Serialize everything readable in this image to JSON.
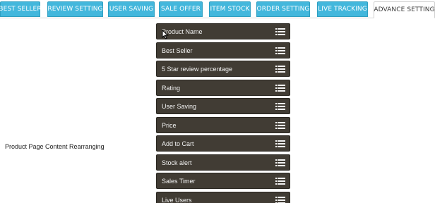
{
  "tabs": [
    {
      "label": "BEST SELLER",
      "active": false
    },
    {
      "label": "REVIEW SETTING",
      "active": false
    },
    {
      "label": "USER SAVING",
      "active": false
    },
    {
      "label": "SALE OFFER",
      "active": false
    },
    {
      "label": "ITEM STOCK",
      "active": false
    },
    {
      "label": "ORDER SETTING",
      "active": false
    },
    {
      "label": "LIVE TRACKING",
      "active": false
    },
    {
      "label": "ADVANCE SETTING",
      "active": true
    }
  ],
  "section_label": "Product Page Content Rearranging",
  "items": [
    {
      "label": "Product Name",
      "icon": "list-icon"
    },
    {
      "label": "Best Seller",
      "icon": "list-icon"
    },
    {
      "label": "5 Star review percentage",
      "icon": "list-icon"
    },
    {
      "label": "Rating",
      "icon": "list-icon"
    },
    {
      "label": "User Saving",
      "icon": "list-icon"
    },
    {
      "label": "Price",
      "icon": "list-icon"
    },
    {
      "label": "Add to Cart",
      "icon": "list-icon"
    },
    {
      "label": "Stock alert",
      "icon": "list-icon"
    },
    {
      "label": "Sales Timer",
      "icon": "list-icon"
    },
    {
      "label": "Live Users",
      "icon": "list-icon"
    }
  ],
  "colors": {
    "tab_bg": "#43b7dc",
    "item_bg": "#413c34",
    "item_text": "#f2f2f2"
  }
}
